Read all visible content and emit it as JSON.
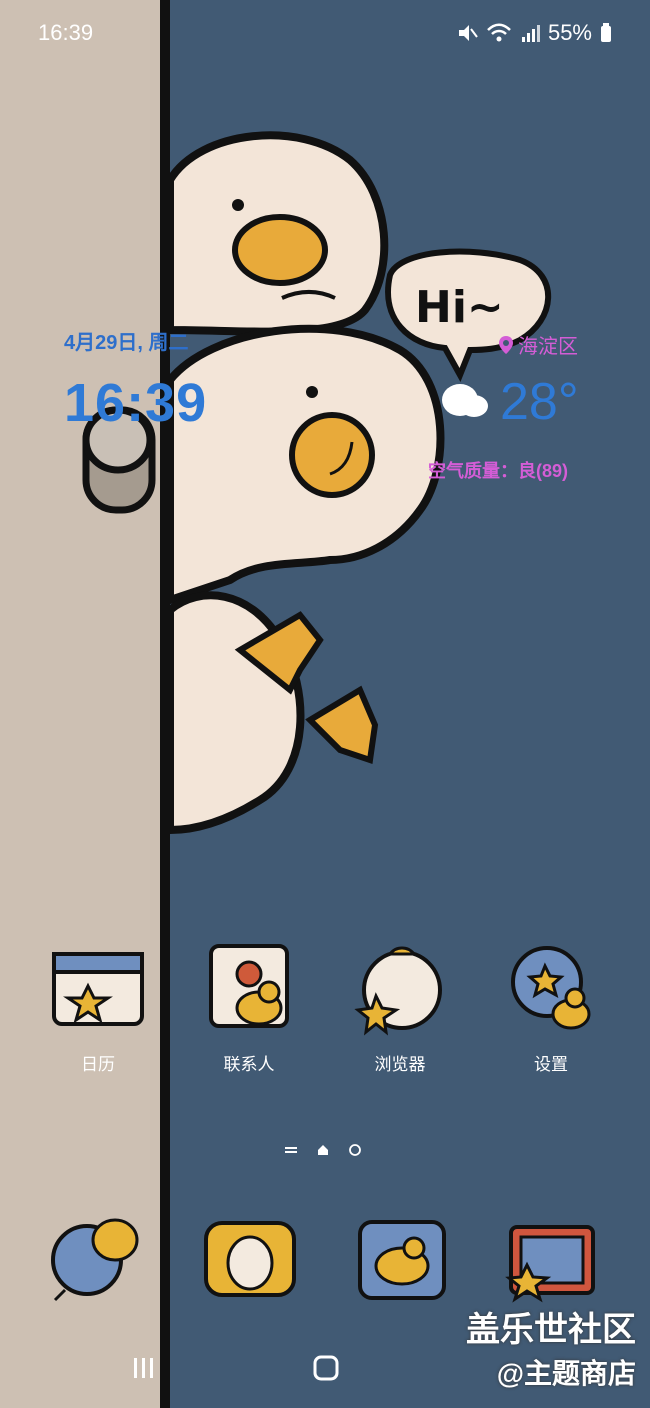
{
  "status_bar": {
    "time": "16:39",
    "battery": "55%"
  },
  "clock_widget": {
    "date": "4月29日, 周二",
    "time": "16:39"
  },
  "weather_widget": {
    "location": "海淀区",
    "temperature": "28°",
    "air_quality": "空气质量：良(89)"
  },
  "speech_bubble": {
    "text": "Hi~"
  },
  "apps": [
    {
      "label": "日历"
    },
    {
      "label": "联系人"
    },
    {
      "label": "浏览器"
    },
    {
      "label": "设置"
    }
  ],
  "watermark": {
    "line1": "盖乐世社区",
    "line2": "@主题商店"
  }
}
